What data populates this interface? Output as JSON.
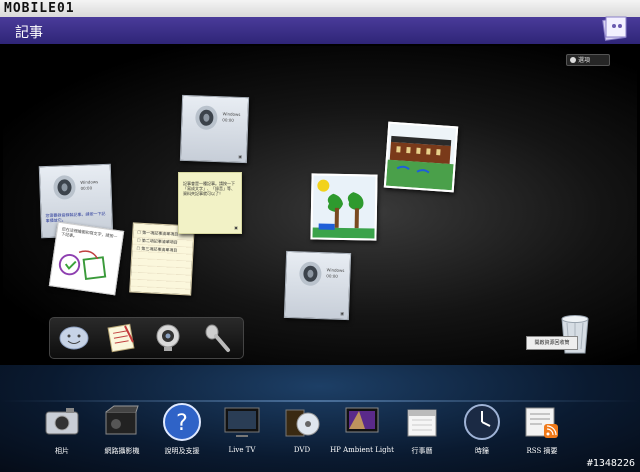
{
  "brand": {
    "logo": "MOBILE01"
  },
  "header": {
    "title": "記事"
  },
  "options": {
    "label": "選項"
  },
  "recycle": {
    "label": "開啟資源回收筒"
  },
  "notes": {
    "audio1": {
      "author": "Windows",
      "time": "00:00"
    },
    "audio2": {
      "author": "Windows",
      "time": "00:00",
      "text": "您需要錄音錄製記事。請按一下記事播放它。"
    },
    "audio3": {
      "author": "Windows",
      "time": "00:00"
    },
    "yellow": {
      "text": "記事會是一種記事。請按一下「寫成文字」、「錄音」等、資料夾記事就可以了！"
    },
    "drawing": {
      "text": "您在這裡繪圖和寫文字，請按一下記事。"
    },
    "list": {
      "items": [
        "第一項記事清單項目",
        "第二項記事清單項目",
        "第三項記事清單項目"
      ]
    }
  },
  "dock": [
    {
      "label": "相片"
    },
    {
      "label": "網路攝影機"
    },
    {
      "label": "說明及支援"
    },
    {
      "label": "Live TV"
    },
    {
      "label": "DVD"
    },
    {
      "label": "HP Ambient Light"
    },
    {
      "label": "行事曆"
    },
    {
      "label": "時鐘"
    },
    {
      "label": "RSS 摘要"
    }
  ],
  "watermark": "#1348226"
}
